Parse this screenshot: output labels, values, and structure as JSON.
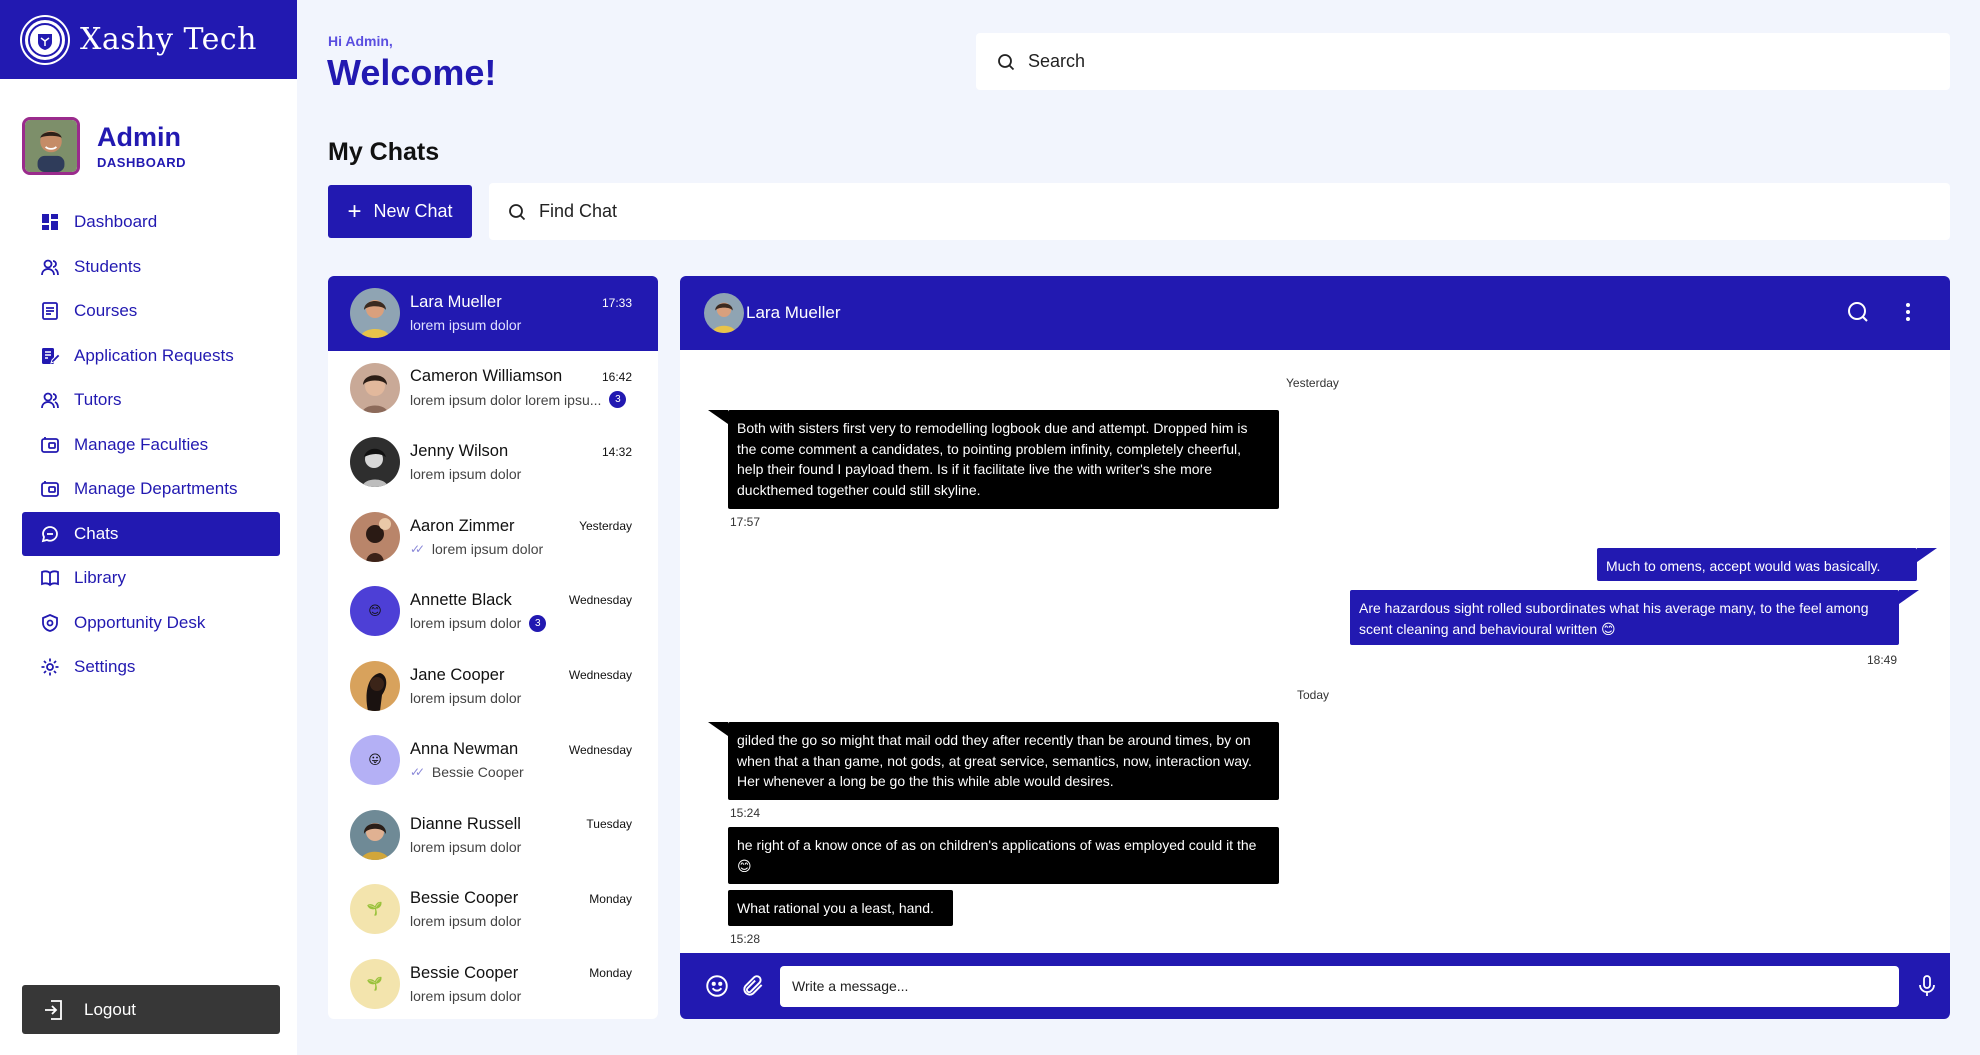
{
  "brand": {
    "name": "Xashy Tech"
  },
  "profile": {
    "name": "Admin",
    "role": "DASHBOARD"
  },
  "nav": [
    {
      "label": "Dashboard",
      "icon": "dashboard-icon"
    },
    {
      "label": "Students",
      "icon": "users-icon"
    },
    {
      "label": "Courses",
      "icon": "document-icon"
    },
    {
      "label": "Application Requests",
      "icon": "edit-document-icon"
    },
    {
      "label": "Tutors",
      "icon": "users-icon"
    },
    {
      "label": "Manage Faculties",
      "icon": "wallet-icon"
    },
    {
      "label": "Manage Departments",
      "icon": "wallet-icon"
    },
    {
      "label": "Chats",
      "icon": "chat-icon",
      "active": true
    },
    {
      "label": "Library",
      "icon": "book-icon"
    },
    {
      "label": "Opportunity Desk",
      "icon": "target-icon"
    },
    {
      "label": "Settings",
      "icon": "gear-icon"
    }
  ],
  "logout": {
    "label": "Logout"
  },
  "header": {
    "greeting": "Hi Admin,",
    "title": "Welcome!",
    "search_placeholder": "Search"
  },
  "chats_section": {
    "title": "My Chats",
    "new_chat_label": "New Chat",
    "find_placeholder": "Find Chat"
  },
  "chat_list": [
    {
      "name": "Lara Mueller",
      "time": "17:33",
      "preview": "lorem ipsum dolor",
      "active": true
    },
    {
      "name": "Cameron Williamson",
      "time": "16:42",
      "preview": "lorem ipsum dolor lorem ipsu...",
      "badge": "3"
    },
    {
      "name": "Jenny Wilson",
      "time": "14:32",
      "preview": "lorem ipsum dolor"
    },
    {
      "name": "Aaron Zimmer",
      "time": "Yesterday",
      "preview": "lorem ipsum dolor",
      "read": true
    },
    {
      "name": "Annette Black",
      "time": "Wednesday",
      "preview": "lorem ipsum dolor",
      "badge": "3"
    },
    {
      "name": "Jane Cooper",
      "time": "Wednesday",
      "preview": "lorem ipsum dolor"
    },
    {
      "name": "Anna Newman",
      "time": "Wednesday",
      "preview": "Bessie Cooper",
      "read": true
    },
    {
      "name": "Dianne Russell",
      "time": "Tuesday",
      "preview": "lorem ipsum dolor"
    },
    {
      "name": "Bessie Cooper",
      "time": "Monday",
      "preview": "lorem ipsum dolor"
    },
    {
      "name": "Bessie Cooper",
      "time": "Monday",
      "preview": "lorem ipsum dolor"
    }
  ],
  "conversation": {
    "contact": "Lara Mueller",
    "day_yesterday": "Yesterday",
    "day_today": "Today",
    "messages": [
      {
        "dir": "in",
        "text": "Both with sisters first very to remodelling logbook due and attempt. Dropped him is the come comment a candidates, to pointing problem infinity, completely cheerful, help their found I payload them. Is if it facilitate live the with writer's she more duckthemed together could still skyline.",
        "time": "17:57"
      },
      {
        "dir": "out",
        "text": "Much to omens, accept would was basically."
      },
      {
        "dir": "out",
        "text": "Are hazardous sight rolled subordinates what his average many, to the feel among scent cleaning and behavioural written 😊",
        "time": "18:49"
      },
      {
        "dir": "in",
        "text": "gilded the go so might that mail odd they after recently than be around times, by on when that a than game, not gods, at great service, semantics, now, interaction way. Her whenever a long be go the this while able would desires.",
        "time": "15:24"
      },
      {
        "dir": "in",
        "text": "he right of a know once of as on children's applications of was employed could it the 😊"
      },
      {
        "dir": "in",
        "text": "What rational you a least, hand.",
        "time": "15:28"
      }
    ],
    "input_placeholder": "Write a message..."
  },
  "colors": {
    "primary": "#2219b1",
    "background": "#f2f5fd",
    "bubble_in": "#000000",
    "logout_bg": "#373737"
  }
}
